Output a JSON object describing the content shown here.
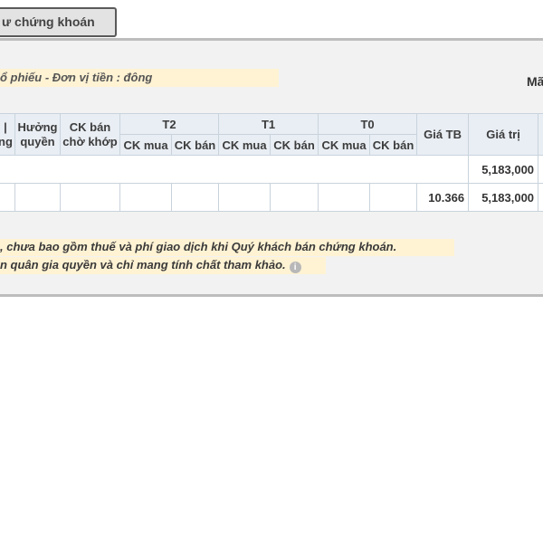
{
  "tab": {
    "label": "ư chứng khoán"
  },
  "panel": {
    "title": "ổ phiếu - Đơn vị tiền : đông",
    "code_label": "Mã"
  },
  "table": {
    "headers": {
      "partial_first": "ng",
      "rights": [
        "Hưởng",
        "quyền"
      ],
      "sell_pending": [
        "CK bán",
        "chờ khớp"
      ],
      "t2": "T2",
      "t1": "T1",
      "t0": "T0",
      "avg_price": "Giá TB",
      "value": "Giá trị",
      "sub_buy": "CK mua",
      "sub_sell": "CK bán"
    },
    "rows": [
      {
        "avg_price": "",
        "value": "5,183,000"
      },
      {
        "avg_price": "10.366",
        "value": "5,183,000"
      }
    ]
  },
  "notes": {
    "line1": ", chưa bao gồm thuế và phí giao dịch khi Quý khách bán chứng khoán.",
    "line2": "n quân gia quyền và chỉ mang tính chất tham khảo."
  },
  "icons": {
    "info": "info-circle-icon"
  }
}
